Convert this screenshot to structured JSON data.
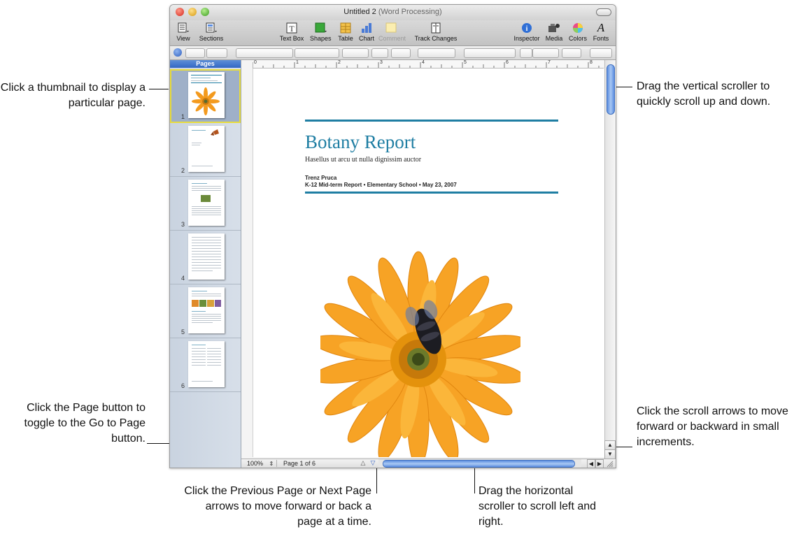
{
  "window": {
    "title": "Untitled 2",
    "title_suffix": "(Word Processing)"
  },
  "toolbar": {
    "view": "View",
    "sections": "Sections",
    "text_box": "Text Box",
    "shapes": "Shapes",
    "table": "Table",
    "chart": "Chart",
    "comment": "Comment",
    "track_changes": "Track Changes",
    "inspector": "Inspector",
    "media": "Media",
    "colors": "Colors",
    "fonts": "Fonts",
    "fonts_glyph": "A"
  },
  "sidebar": {
    "header": "Pages",
    "pages": [
      {
        "number": "1"
      },
      {
        "number": "2"
      },
      {
        "number": "3"
      },
      {
        "number": "4"
      },
      {
        "number": "5"
      },
      {
        "number": "6"
      }
    ]
  },
  "ruler": {
    "marks": [
      "0",
      "1",
      "2",
      "3",
      "4",
      "5",
      "6",
      "7",
      "8"
    ]
  },
  "document": {
    "title": "Botany Report",
    "subtitle": "Hasellus ut arcu ut nulla dignissim auctor",
    "author": "Trenz Pruca",
    "meta": "K-12 Mid-term Report • Elementary School • May 23, 2007"
  },
  "statusbar": {
    "zoom": "100%",
    "page_indicator": "Page 1 of 6"
  },
  "callouts": {
    "thumbnail": "Click a thumbnail to display a particular page.",
    "page_button": "Click the Page button to toggle to the Go to Page button.",
    "prev_next": "Click the Previous Page or Next Page arrows to move forward or back a page at a time.",
    "horizontal": "Drag the horizontal scroller to scroll left and right.",
    "vertical": "Drag the vertical scroller to quickly scroll up and down.",
    "arrows": "Click the scroll arrows to move forward or backward in small increments."
  },
  "colors": {
    "accent_blue": "#1f7ea3",
    "selection_yellow": "#e8dc3c",
    "scroller_blue": "#5b8de0"
  }
}
